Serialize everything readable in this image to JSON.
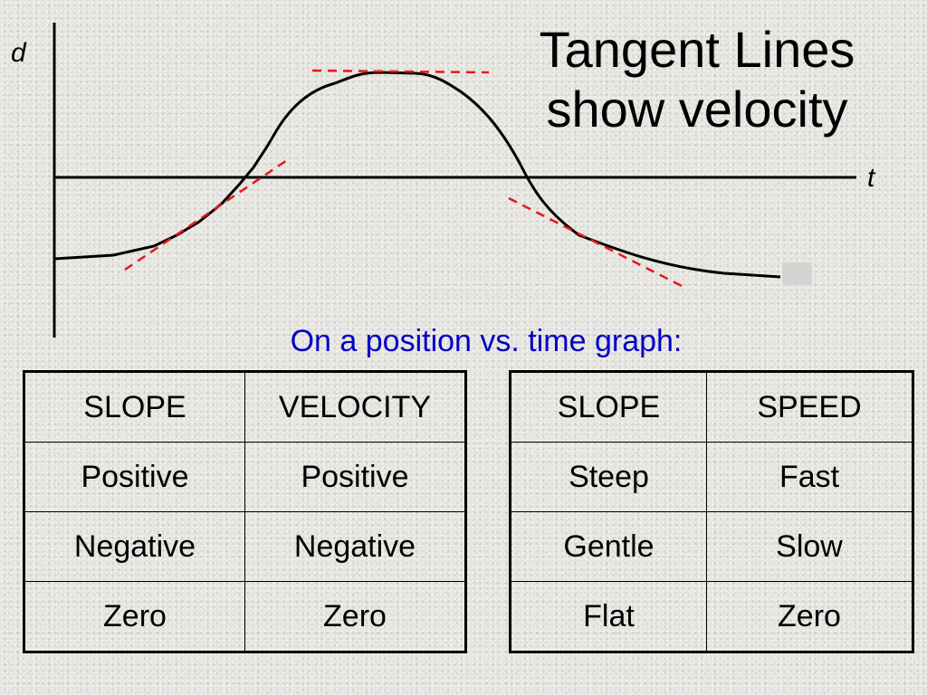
{
  "title": {
    "line1": "Tangent Lines",
    "line2": "show velocity"
  },
  "subtitle": "On a position vs. time graph:",
  "colors": {
    "subtitle": "#0000c8",
    "tangent": "#e8161b",
    "curve": "#000000"
  },
  "graph": {
    "y_axis_label": "d",
    "x_axis_label": "t",
    "curve_description": "position curve rising from negative, peaking above axis, then falling back below axis and leveling off",
    "tangent_lines": [
      {
        "label": "positive-slope tangent",
        "slope": "positive"
      },
      {
        "label": "zero-slope tangent at peak",
        "slope": "zero"
      },
      {
        "label": "negative-slope tangent",
        "slope": "negative"
      }
    ]
  },
  "tables": {
    "velocity": {
      "headers": [
        "SLOPE",
        "VELOCITY"
      ],
      "rows": [
        [
          "Positive",
          "Positive"
        ],
        [
          "Negative",
          "Negative"
        ],
        [
          "Zero",
          "Zero"
        ]
      ]
    },
    "speed": {
      "headers": [
        "SLOPE",
        "SPEED"
      ],
      "rows": [
        [
          "Steep",
          "Fast"
        ],
        [
          "Gentle",
          "Slow"
        ],
        [
          "Flat",
          "Zero"
        ]
      ]
    }
  }
}
